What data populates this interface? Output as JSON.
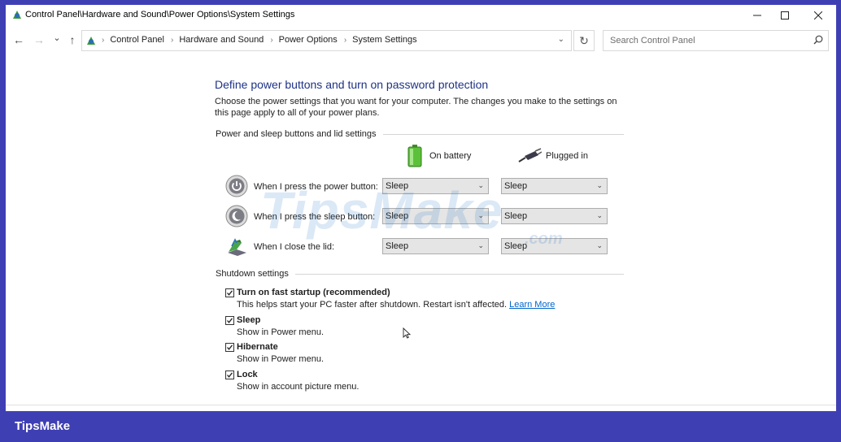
{
  "window": {
    "title": "Control Panel\\Hardware and Sound\\Power Options\\System Settings",
    "controls": {
      "minimize": "—",
      "maximize": "☐",
      "close": "✕"
    }
  },
  "nav": {
    "back": "←",
    "forward": "→",
    "recent": "⌄",
    "up": "↑",
    "breadcrumb": [
      "Control Panel",
      "Hardware and Sound",
      "Power Options",
      "System Settings"
    ],
    "breadcrumb_sep": "›",
    "dropdown": "⌄",
    "refresh": "↻",
    "search_placeholder": "Search Control Panel"
  },
  "page": {
    "heading": "Define power buttons and turn on password protection",
    "intro": "Choose the power settings that you want for your computer. The changes you make to the settings on this page apply to all of your power plans.",
    "section_power": "Power and sleep buttons and lid settings",
    "col_battery": "On battery",
    "col_plugged": "Plugged in",
    "rows": [
      {
        "label": "When I press the power button:",
        "battery": "Sleep",
        "plugged": "Sleep",
        "icon": "power-icon"
      },
      {
        "label": "When I press the sleep button:",
        "battery": "Sleep",
        "plugged": "Sleep",
        "icon": "sleep-icon"
      },
      {
        "label": "When I close the lid:",
        "battery": "Sleep",
        "plugged": "Sleep",
        "icon": "laptop-lid-icon"
      }
    ],
    "section_shutdown": "Shutdown settings",
    "shutdown": [
      {
        "label": "Turn on fast startup (recommended)",
        "desc": "This helps start your PC faster after shutdown. Restart isn't affected.",
        "link": "Learn More",
        "checked": true
      },
      {
        "label": "Sleep",
        "desc": "Show in Power menu.",
        "checked": true
      },
      {
        "label": "Hibernate",
        "desc": "Show in Power menu.",
        "checked": true
      },
      {
        "label": "Lock",
        "desc": "Show in account picture menu.",
        "checked": true
      }
    ]
  },
  "watermark": {
    "main": "TipsMake",
    "suffix": ".com"
  },
  "footer_brand": "TipsMake",
  "colors": {
    "frame": "#3f3fb4",
    "heading": "#1e3287",
    "link": "#0066cc"
  }
}
